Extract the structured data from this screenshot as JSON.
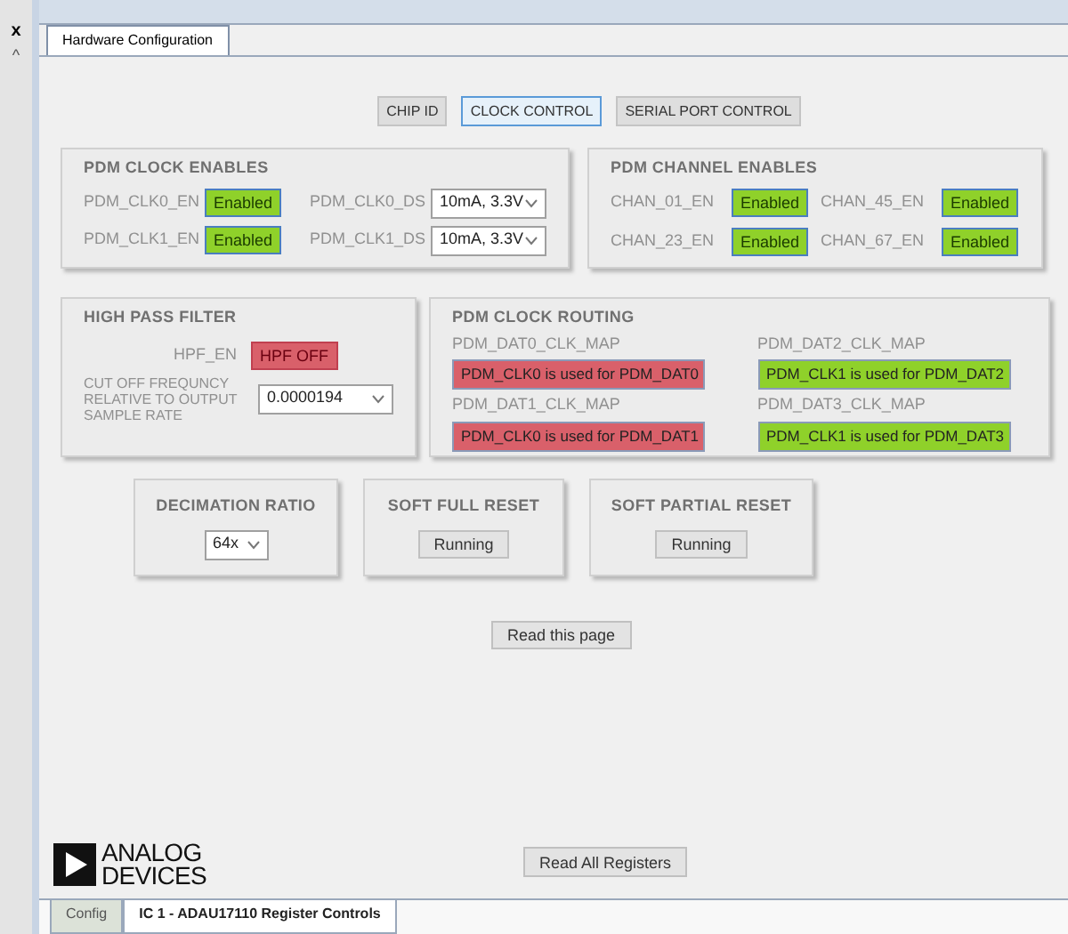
{
  "side_strip": {
    "close": "x",
    "collapse": "^"
  },
  "window_tab": {
    "label": "Hardware Configuration",
    "selected": true
  },
  "page_buttons": [
    {
      "label": "CHIP ID",
      "selected": false
    },
    {
      "label": "CLOCK CONTROL",
      "selected": true
    },
    {
      "label": "SERIAL PORT CONTROL",
      "selected": false
    }
  ],
  "clock_enables": {
    "title": "PDM CLOCK ENABLES",
    "rows": [
      {
        "en_label": "PDM_CLK0_EN",
        "status": "Enabled",
        "on": true,
        "ds_label": "PDM_CLK0_DS",
        "ds_value": "10mA, 3.3V"
      },
      {
        "en_label": "PDM_CLK1_EN",
        "status": "Enabled",
        "on": true,
        "ds_label": "PDM_CLK1_DS",
        "ds_value": "10mA, 3.3V"
      }
    ]
  },
  "channel_enables": {
    "title": "PDM CHANNEL ENABLES",
    "items": [
      {
        "label": "CHAN_01_EN",
        "status": "Enabled",
        "on": true
      },
      {
        "label": "CHAN_45_EN",
        "status": "Enabled",
        "on": true
      },
      {
        "label": "CHAN_23_EN",
        "status": "Enabled",
        "on": true
      },
      {
        "label": "CHAN_67_EN",
        "status": "Enabled",
        "on": true
      }
    ]
  },
  "hpf": {
    "title": "HIGH PASS FILTER",
    "enable_label": "HPF_EN",
    "status": "HPF OFF",
    "on": false,
    "cutoff_label": "CUT OFF FREQUNCY RELATIVE TO OUTPUT SAMPLE RATE",
    "cutoff_value": "0.0000194"
  },
  "routing": {
    "title": "PDM CLOCK ROUTING",
    "maps": [
      {
        "label": "PDM_DAT0_CLK_MAP",
        "value": "PDM_CLK0 is used for PDM_DAT0",
        "color": "#d9606a"
      },
      {
        "label": "PDM_DAT2_CLK_MAP",
        "value": "PDM_CLK1 is used for PDM_DAT2",
        "color": "#8fd12a"
      },
      {
        "label": "PDM_DAT1_CLK_MAP",
        "value": "PDM_CLK0 is used for PDM_DAT1",
        "color": "#d9606a"
      },
      {
        "label": "PDM_DAT3_CLK_MAP",
        "value": "PDM_CLK1 is used for PDM_DAT3",
        "color": "#8fd12a"
      }
    ]
  },
  "decimation": {
    "title": "DECIMATION RATIO",
    "value": "64x"
  },
  "resets": [
    {
      "title": "SOFT FULL RESET",
      "button": "Running"
    },
    {
      "title": "SOFT PARTIAL RESET",
      "button": "Running"
    }
  ],
  "read_page": "Read this page",
  "logo": {
    "line1": "ANALOG",
    "line2": "DEVICES"
  },
  "read_all": "Read All Registers",
  "bottom_tabs": [
    {
      "label": "Config",
      "selected": false
    },
    {
      "label": "IC 1 - ADAU17110 Register Controls",
      "selected": true
    }
  ]
}
